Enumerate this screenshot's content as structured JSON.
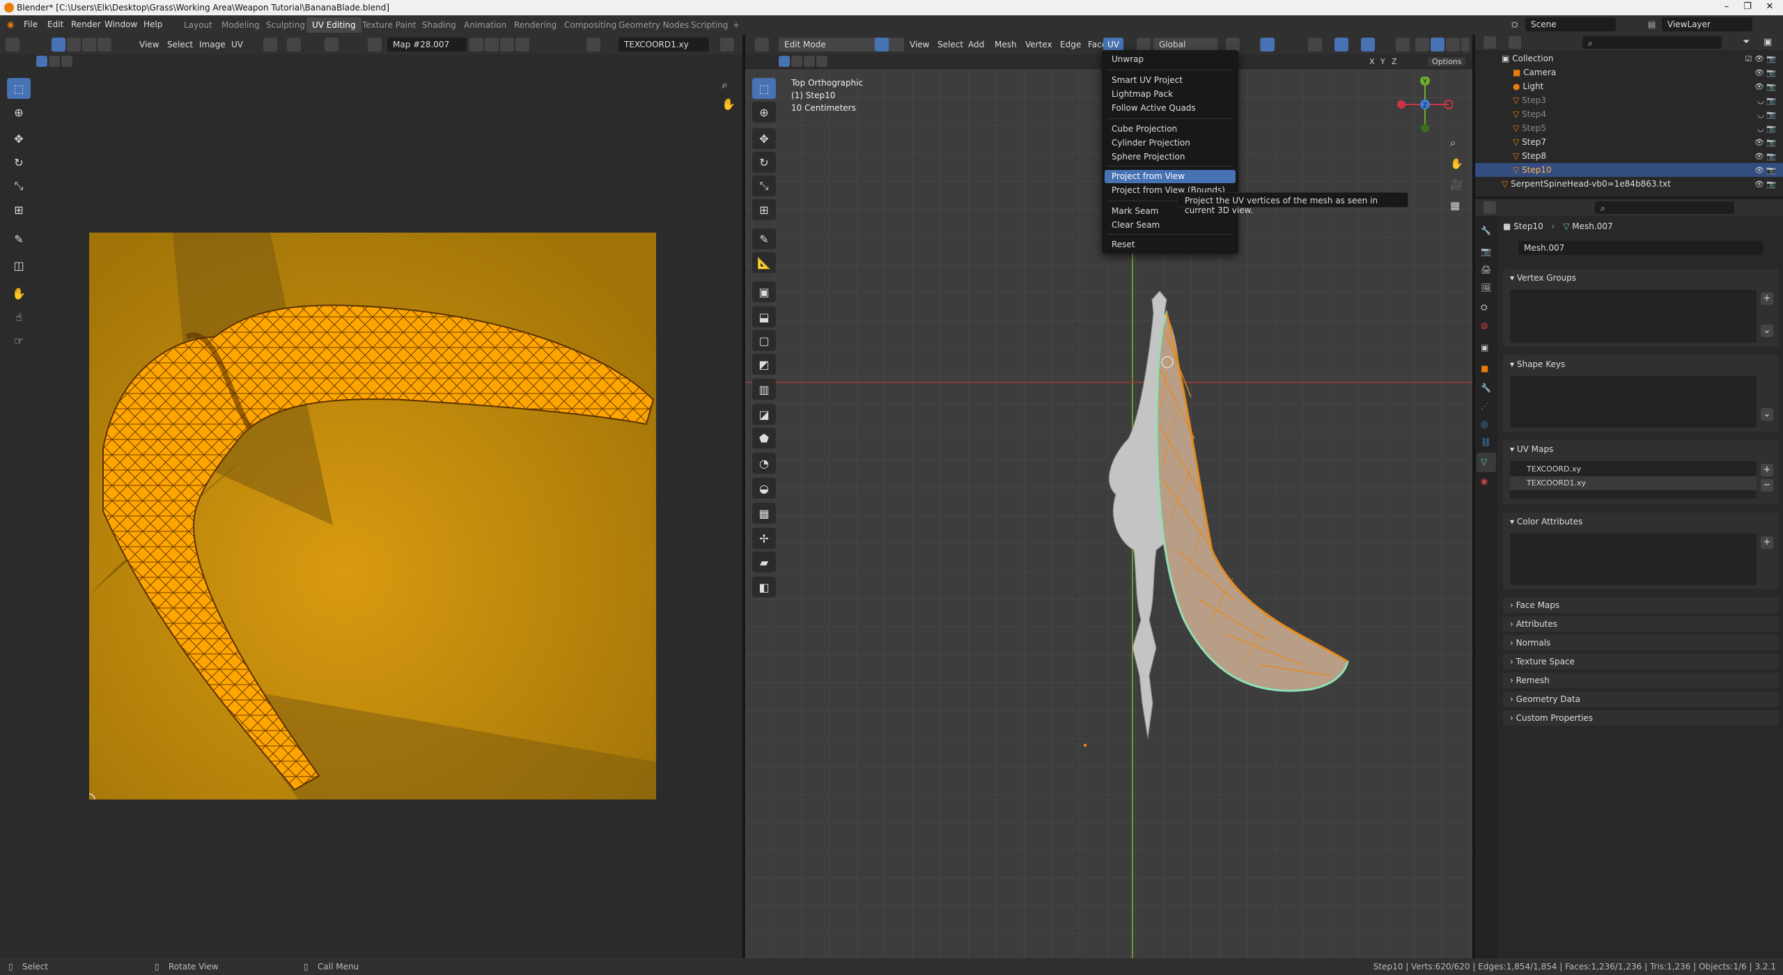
{
  "window": {
    "title": "Blender* [C:\\Users\\Elk\\Desktop\\Grass\\Working Area\\Weapon Tutorial\\BananaBlade.blend]"
  },
  "menu": [
    "File",
    "Edit",
    "Render",
    "Window",
    "Help"
  ],
  "workspaces": [
    "Layout",
    "Modeling",
    "Sculpting",
    "UV Editing",
    "Texture Paint",
    "Shading",
    "Animation",
    "Rendering",
    "Compositing",
    "Geometry Nodes",
    "Scripting",
    "+"
  ],
  "scene": {
    "name": "Scene",
    "view_layer": "ViewLayer"
  },
  "uv_editor": {
    "menus": [
      "View",
      "Select",
      "Image",
      "UV"
    ],
    "image_name": "Map #28.007",
    "uv_map": "TEXCOORD1.xy"
  },
  "viewport": {
    "mode": "Edit Mode",
    "menus": [
      "View",
      "Select",
      "Add",
      "Mesh",
      "Vertex",
      "Edge",
      "Face",
      "UV"
    ],
    "orientation": "Global",
    "options": "Options",
    "axes": [
      "X",
      "Y",
      "Z"
    ],
    "info": {
      "view": "Top Orthographic",
      "object": "(1) Step10",
      "scale": "10 Centimeters"
    },
    "gizmo": {
      "y": "Y",
      "z": "Z"
    }
  },
  "uv_menu": {
    "items": [
      {
        "label": "Unwrap"
      },
      {
        "label": "Smart UV Project"
      },
      {
        "label": "Lightmap Pack"
      },
      {
        "label": "Follow Active Quads"
      },
      {
        "label": "Cube Projection"
      },
      {
        "label": "Cylinder Projection"
      },
      {
        "label": "Sphere Projection"
      },
      {
        "label": "Project from View"
      },
      {
        "label": "Project from View (Bounds)"
      },
      {
        "label": "Mark Seam"
      },
      {
        "label": "Clear Seam"
      },
      {
        "label": "Reset"
      }
    ],
    "tooltip": "Project the UV vertices of the mesh as seen in current 3D view."
  },
  "outliner": {
    "items": [
      {
        "label": "Collection"
      },
      {
        "label": "Camera"
      },
      {
        "label": "Light"
      },
      {
        "label": "Step3"
      },
      {
        "label": "Step4"
      },
      {
        "label": "Step5"
      },
      {
        "label": "Step7"
      },
      {
        "label": "Step8"
      },
      {
        "label": "Step10"
      },
      {
        "label": "SerpentSpineHead-vb0=1e84b863.txt"
      }
    ]
  },
  "properties": {
    "breadcrumb_object": "Step10",
    "breadcrumb_mesh": "Mesh.007",
    "mesh_name": "Mesh.007",
    "panels": {
      "vertex_groups": "Vertex Groups",
      "shape_keys": "Shape Keys",
      "uv_maps": "UV Maps",
      "color_attributes": "Color Attributes"
    },
    "uv_maps": [
      "TEXCOORD.xy",
      "TEXCOORD1.xy"
    ],
    "collapsed": [
      "Face Maps",
      "Attributes",
      "Normals",
      "Texture Space",
      "Remesh",
      "Geometry Data",
      "Custom Properties"
    ]
  },
  "status": {
    "left": [
      "Select",
      "Rotate View",
      "Call Menu"
    ],
    "right": "Step10 | Verts:620/620 | Edges:1,854/1,854 | Faces:1,236/1,236 | Tris:1,236 | Objects:1/6 | 3.2.1"
  },
  "colors": {
    "accent": "#4772b3",
    "uv_fill": "#ffa500",
    "uv_bg": "#b8860b",
    "mesh_edge": "#e8881a"
  }
}
